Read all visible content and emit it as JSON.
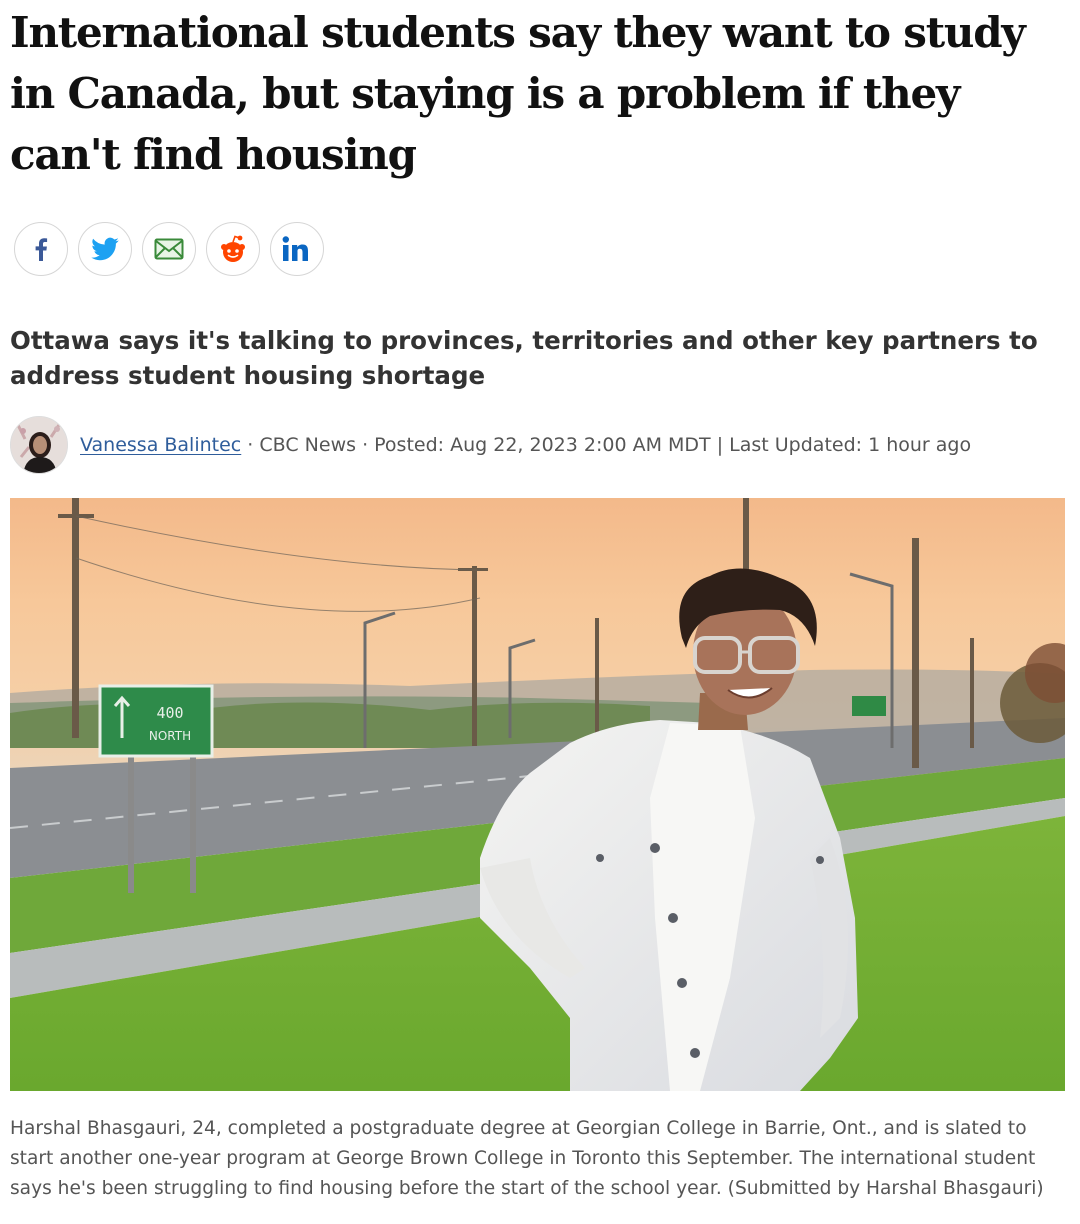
{
  "article": {
    "headline": "International students say they want to study in Canada, but staying is a problem if they can't find housing",
    "deck": "Ottawa says it's talking to provinces, territories and other key partners to address student housing shortage",
    "byline": {
      "author": "Vanessa Balintec",
      "outlet": "CBC News",
      "posted": "Posted: Aug 22, 2023 2:00 AM MDT",
      "updated": "Last Updated: 1 hour ago",
      "dot_separator": "·",
      "pipe_separator": "|"
    },
    "photo": {
      "sign_route": "400",
      "sign_direction": "NORTH"
    },
    "caption": "Harshal Bhasgauri, 24, completed a postgraduate degree at Georgian College in Barrie, Ont., and is slated to start another one-year program at George Brown College in Toronto this September. The international student says he's been struggling to find housing before the start of the school year. (Submitted by Harshal Bhasgauri)"
  },
  "share": {
    "buttons": [
      {
        "icon": "facebook-icon",
        "color": "#3b5998"
      },
      {
        "icon": "twitter-icon",
        "color": "#1da1f2"
      },
      {
        "icon": "email-icon",
        "color": "#3a8a3a"
      },
      {
        "icon": "reddit-icon",
        "color": "#ff4500"
      },
      {
        "icon": "linkedin-icon",
        "color": "#0a66c2"
      }
    ]
  },
  "colors": {
    "headline": "#111111",
    "author_link": "#2f5d9b",
    "meta_text": "#555555",
    "share_border": "#d6d6d6"
  }
}
